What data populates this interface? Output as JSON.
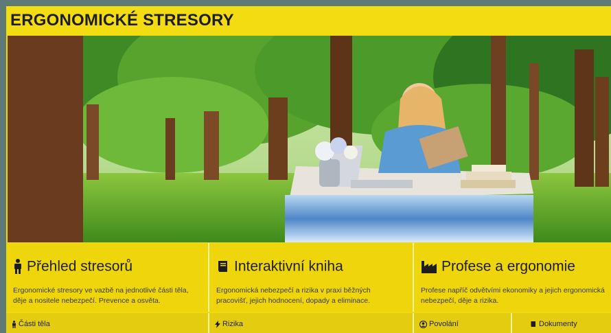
{
  "header": {
    "title": "ERGONOMICKÉ STRESORY"
  },
  "hero": {
    "image": "forest-office-waterfall-illustration"
  },
  "cards": [
    {
      "icon": "standing-person-icon",
      "title": "Přehled stresorů",
      "description": "Ergonomické stresory ve vazbě na jednotlivé části těla, děje a nositele nebezpečí. Prevence a osvěta."
    },
    {
      "icon": "book-icon",
      "title": "Interaktivní kniha",
      "description": "Ergonomická nebezpečí a rizika v praxi běžných pracovišť, jejich hodnocení, dopady a eliminace."
    },
    {
      "icon": "factory-icon",
      "title": "Profese a ergonomie",
      "description": "Profese napříč odvětvími ekonomiky a jejich ergonomická nebezpečí, děje a rizika."
    }
  ],
  "bottom_tabs": [
    {
      "icon": "standing-person-icon",
      "label": "Části těla"
    },
    {
      "icon": "bolt-icon",
      "label": "Rizika"
    },
    {
      "icon": "user-circle-icon",
      "label": "Povolání"
    },
    {
      "icon": "book-icon",
      "label": "Dokumenty"
    }
  ],
  "colors": {
    "accent": "#f4dc12",
    "card": "#eed50c",
    "tab": "#e4cc10",
    "frame": "#5e7a76"
  }
}
